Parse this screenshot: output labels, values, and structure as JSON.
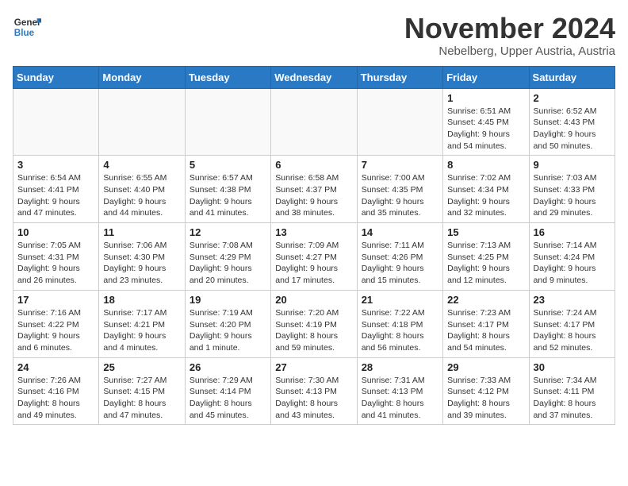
{
  "header": {
    "logo_line1": "General",
    "logo_line2": "Blue",
    "month": "November 2024",
    "location": "Nebelberg, Upper Austria, Austria"
  },
  "weekdays": [
    "Sunday",
    "Monday",
    "Tuesday",
    "Wednesday",
    "Thursday",
    "Friday",
    "Saturday"
  ],
  "weeks": [
    [
      {
        "day": "",
        "info": ""
      },
      {
        "day": "",
        "info": ""
      },
      {
        "day": "",
        "info": ""
      },
      {
        "day": "",
        "info": ""
      },
      {
        "day": "",
        "info": ""
      },
      {
        "day": "1",
        "info": "Sunrise: 6:51 AM\nSunset: 4:45 PM\nDaylight: 9 hours\nand 54 minutes."
      },
      {
        "day": "2",
        "info": "Sunrise: 6:52 AM\nSunset: 4:43 PM\nDaylight: 9 hours\nand 50 minutes."
      }
    ],
    [
      {
        "day": "3",
        "info": "Sunrise: 6:54 AM\nSunset: 4:41 PM\nDaylight: 9 hours\nand 47 minutes."
      },
      {
        "day": "4",
        "info": "Sunrise: 6:55 AM\nSunset: 4:40 PM\nDaylight: 9 hours\nand 44 minutes."
      },
      {
        "day": "5",
        "info": "Sunrise: 6:57 AM\nSunset: 4:38 PM\nDaylight: 9 hours\nand 41 minutes."
      },
      {
        "day": "6",
        "info": "Sunrise: 6:58 AM\nSunset: 4:37 PM\nDaylight: 9 hours\nand 38 minutes."
      },
      {
        "day": "7",
        "info": "Sunrise: 7:00 AM\nSunset: 4:35 PM\nDaylight: 9 hours\nand 35 minutes."
      },
      {
        "day": "8",
        "info": "Sunrise: 7:02 AM\nSunset: 4:34 PM\nDaylight: 9 hours\nand 32 minutes."
      },
      {
        "day": "9",
        "info": "Sunrise: 7:03 AM\nSunset: 4:33 PM\nDaylight: 9 hours\nand 29 minutes."
      }
    ],
    [
      {
        "day": "10",
        "info": "Sunrise: 7:05 AM\nSunset: 4:31 PM\nDaylight: 9 hours\nand 26 minutes."
      },
      {
        "day": "11",
        "info": "Sunrise: 7:06 AM\nSunset: 4:30 PM\nDaylight: 9 hours\nand 23 minutes."
      },
      {
        "day": "12",
        "info": "Sunrise: 7:08 AM\nSunset: 4:29 PM\nDaylight: 9 hours\nand 20 minutes."
      },
      {
        "day": "13",
        "info": "Sunrise: 7:09 AM\nSunset: 4:27 PM\nDaylight: 9 hours\nand 17 minutes."
      },
      {
        "day": "14",
        "info": "Sunrise: 7:11 AM\nSunset: 4:26 PM\nDaylight: 9 hours\nand 15 minutes."
      },
      {
        "day": "15",
        "info": "Sunrise: 7:13 AM\nSunset: 4:25 PM\nDaylight: 9 hours\nand 12 minutes."
      },
      {
        "day": "16",
        "info": "Sunrise: 7:14 AM\nSunset: 4:24 PM\nDaylight: 9 hours\nand 9 minutes."
      }
    ],
    [
      {
        "day": "17",
        "info": "Sunrise: 7:16 AM\nSunset: 4:22 PM\nDaylight: 9 hours\nand 6 minutes."
      },
      {
        "day": "18",
        "info": "Sunrise: 7:17 AM\nSunset: 4:21 PM\nDaylight: 9 hours\nand 4 minutes."
      },
      {
        "day": "19",
        "info": "Sunrise: 7:19 AM\nSunset: 4:20 PM\nDaylight: 9 hours\nand 1 minute."
      },
      {
        "day": "20",
        "info": "Sunrise: 7:20 AM\nSunset: 4:19 PM\nDaylight: 8 hours\nand 59 minutes."
      },
      {
        "day": "21",
        "info": "Sunrise: 7:22 AM\nSunset: 4:18 PM\nDaylight: 8 hours\nand 56 minutes."
      },
      {
        "day": "22",
        "info": "Sunrise: 7:23 AM\nSunset: 4:17 PM\nDaylight: 8 hours\nand 54 minutes."
      },
      {
        "day": "23",
        "info": "Sunrise: 7:24 AM\nSunset: 4:17 PM\nDaylight: 8 hours\nand 52 minutes."
      }
    ],
    [
      {
        "day": "24",
        "info": "Sunrise: 7:26 AM\nSunset: 4:16 PM\nDaylight: 8 hours\nand 49 minutes."
      },
      {
        "day": "25",
        "info": "Sunrise: 7:27 AM\nSunset: 4:15 PM\nDaylight: 8 hours\nand 47 minutes."
      },
      {
        "day": "26",
        "info": "Sunrise: 7:29 AM\nSunset: 4:14 PM\nDaylight: 8 hours\nand 45 minutes."
      },
      {
        "day": "27",
        "info": "Sunrise: 7:30 AM\nSunset: 4:13 PM\nDaylight: 8 hours\nand 43 minutes."
      },
      {
        "day": "28",
        "info": "Sunrise: 7:31 AM\nSunset: 4:13 PM\nDaylight: 8 hours\nand 41 minutes."
      },
      {
        "day": "29",
        "info": "Sunrise: 7:33 AM\nSunset: 4:12 PM\nDaylight: 8 hours\nand 39 minutes."
      },
      {
        "day": "30",
        "info": "Sunrise: 7:34 AM\nSunset: 4:11 PM\nDaylight: 8 hours\nand 37 minutes."
      }
    ]
  ]
}
